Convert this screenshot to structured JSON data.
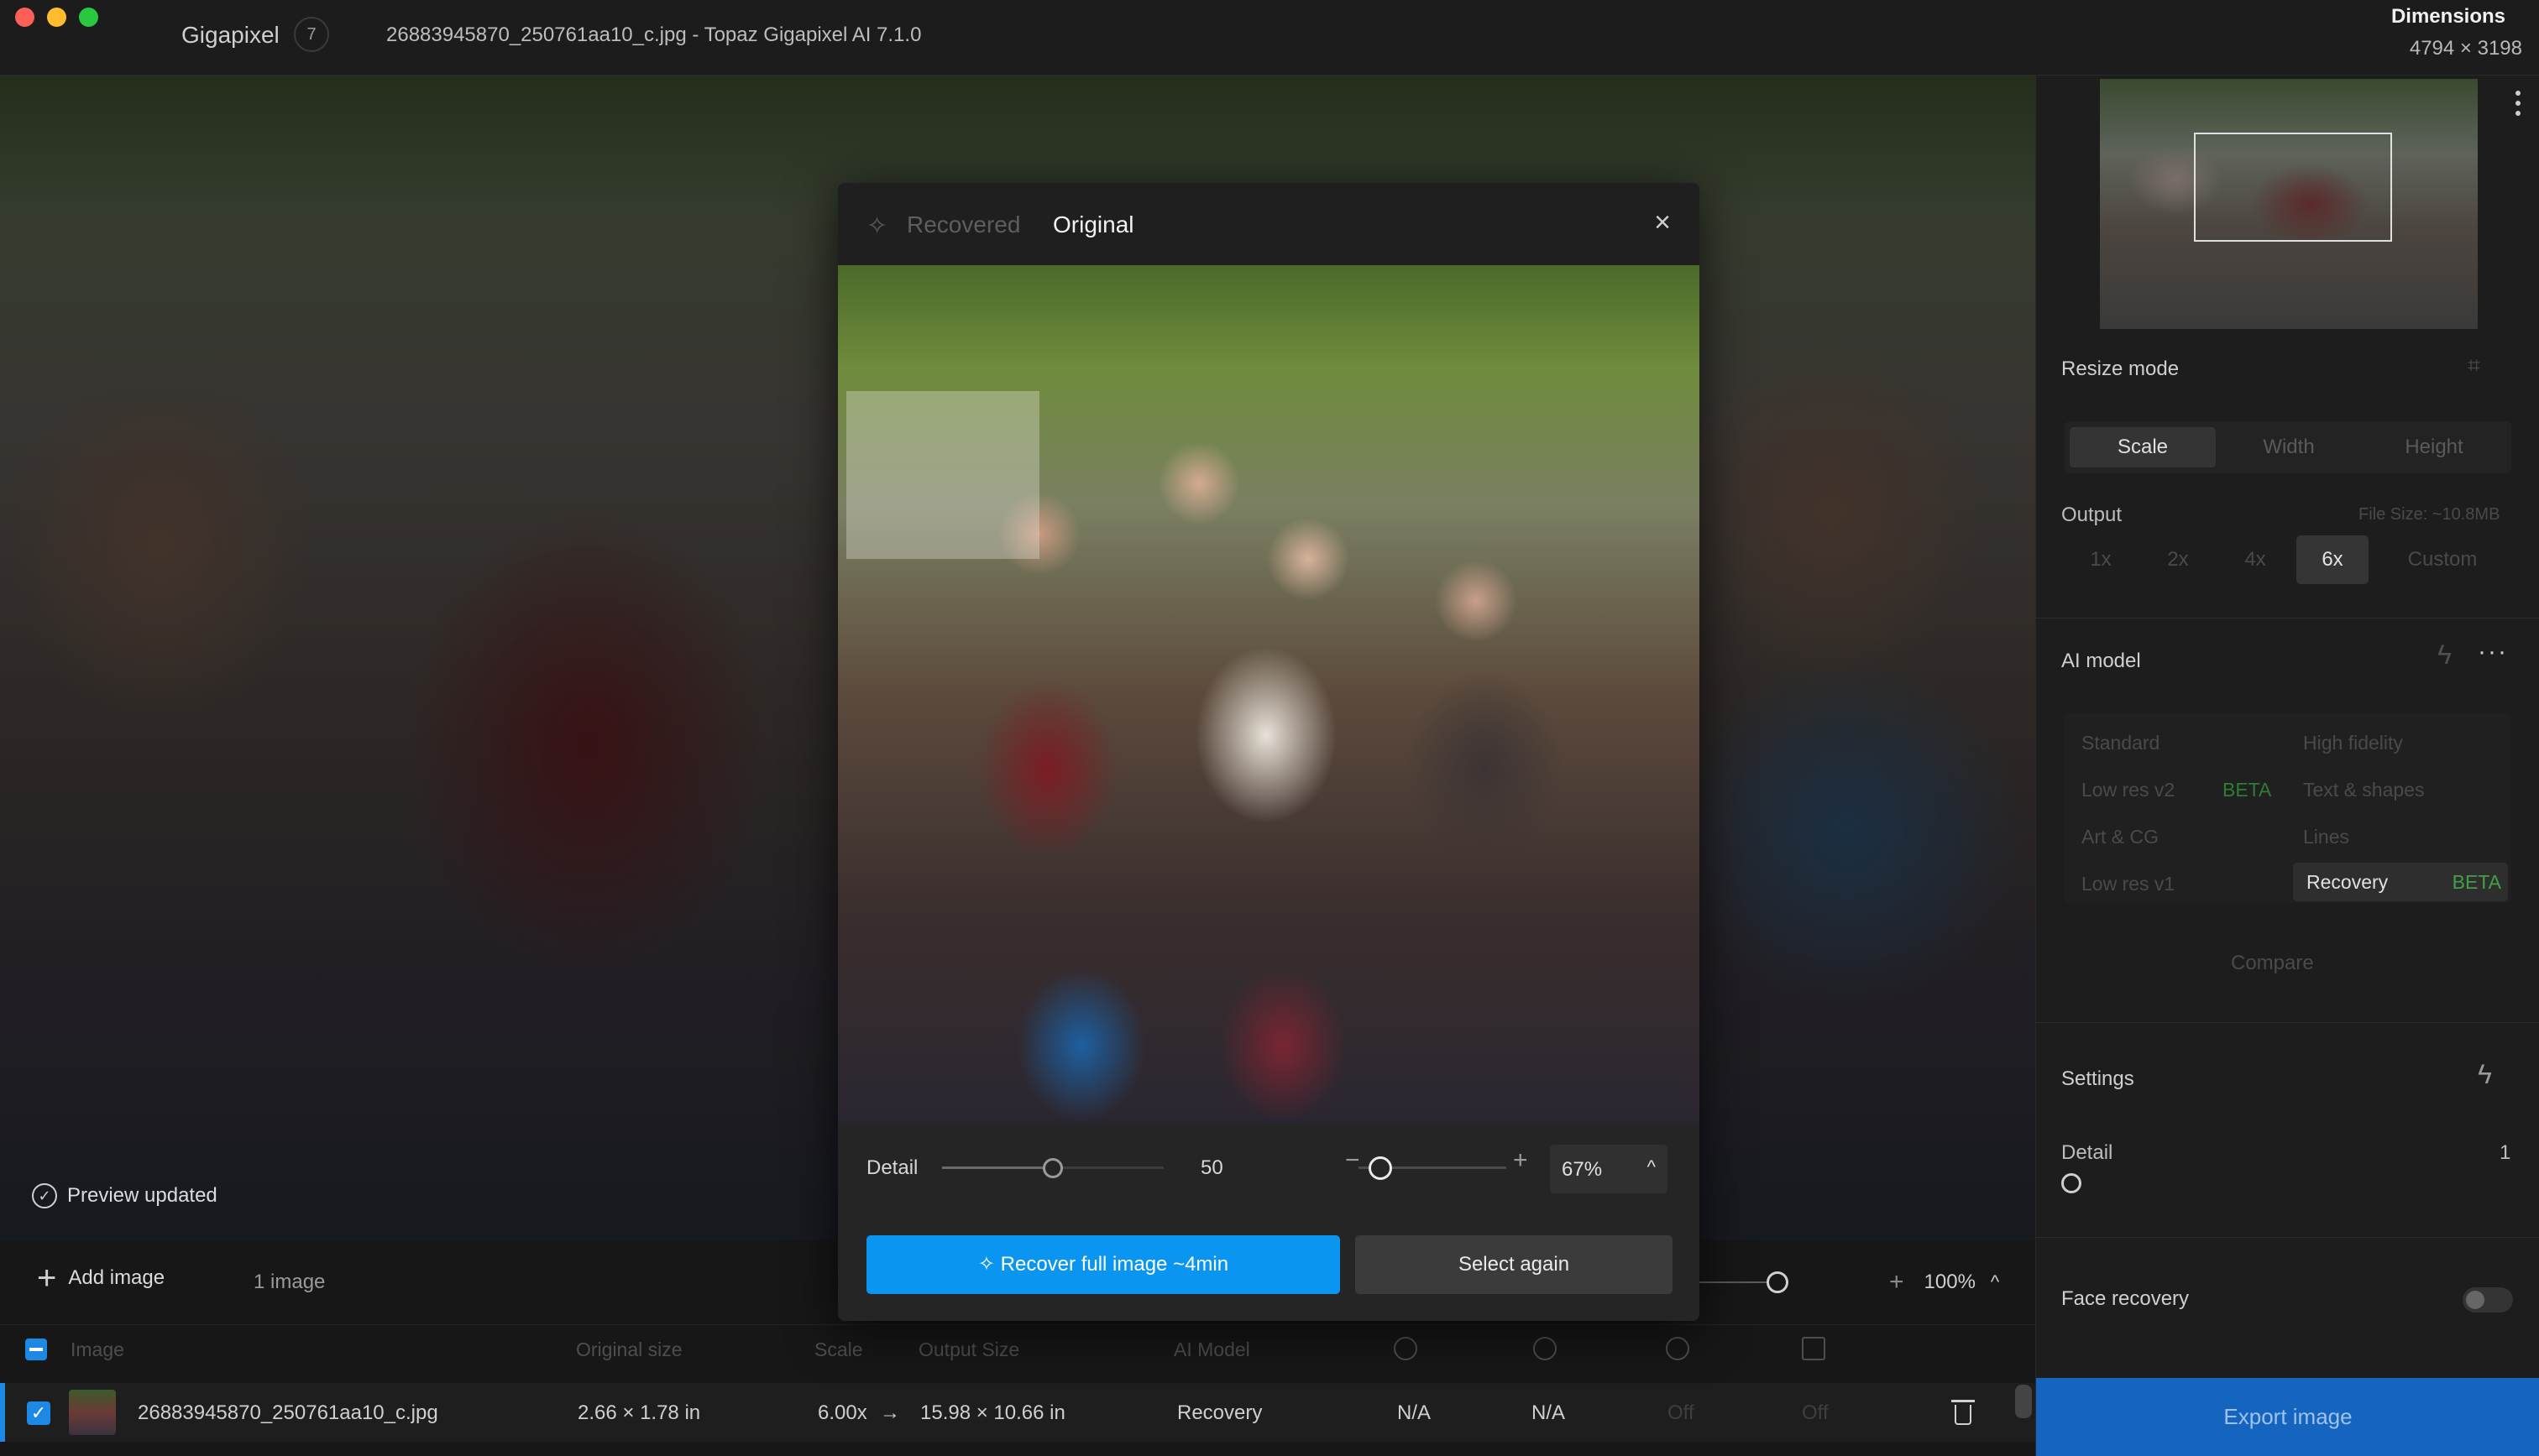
{
  "titlebar": {
    "app_name": "Gigapixel",
    "app_count": "7",
    "window_title": "26883945870_250761aa10_c.jpg - Topaz Gigapixel AI 7.1.0",
    "dimensions_label": "Dimensions",
    "dimensions_value": "4794 × 3198"
  },
  "viewer": {
    "preview_status": "Preview updated",
    "check_glyph": "✓"
  },
  "bottom": {
    "add_image_label": "Add image",
    "plus_glyph": "+",
    "image_count": "1 image",
    "zoom_value": "100%",
    "zoom_plus": "+",
    "chevron": "^"
  },
  "table": {
    "headers": {
      "image": "Image",
      "original_size": "Original size",
      "scale": "Scale",
      "output_size": "Output Size",
      "ai_model": "AI Model"
    },
    "rows": [
      {
        "check": "✓",
        "filename": "26883945870_250761aa10_c.jpg",
        "original_size": "2.66 × 1.78 in",
        "scale": "6.00x",
        "arrow": "→",
        "output_size": "15.98 × 10.66 in",
        "ai_model": "Recovery",
        "col_a": "N/A",
        "col_b": "N/A",
        "col_c": "Off",
        "col_d": "Off"
      }
    ]
  },
  "right_panel": {
    "resize_mode_title": "Resize mode",
    "resize_tabs": [
      "Scale",
      "Width",
      "Height"
    ],
    "output_label": "Output",
    "file_size": "File Size: ~10.8MB",
    "output_options": [
      "1x",
      "2x",
      "4x",
      "6x",
      "Custom"
    ],
    "ai_model_title": "AI model",
    "kebab_glyph": "···",
    "models": {
      "standard": "Standard",
      "high_fidelity": "High fidelity",
      "low_res_v2": "Low res v2",
      "low_res_v2_badge": "BETA",
      "text_shapes": "Text & shapes",
      "art_cg": "Art & CG",
      "lines": "Lines",
      "low_res_v1": "Low res v1",
      "recovery": "Recovery",
      "recovery_badge": "BETA"
    },
    "compare_label": "Compare",
    "settings_title": "Settings",
    "detail_label": "Detail",
    "detail_value": "1",
    "face_recovery_label": "Face recovery",
    "export_label": "Export image"
  },
  "modal": {
    "tab_recovered": "Recovered",
    "tab_original": "Original",
    "close_glyph": "×",
    "sparkle_glyph": "✧",
    "detail_label": "Detail",
    "detail_value": "50",
    "detail_level": 0.5,
    "zoom_minus": "−",
    "zoom_plus": "+",
    "zoom_value": "67%",
    "zoom_chevron": "^",
    "recover_button": "✧ Recover full image ~4min",
    "select_again_button": "Select again"
  },
  "colors": {
    "accent_blue": "#0a96f0",
    "export_blue": "#1565c0",
    "beta_green": "#43a047",
    "checkbox_blue": "#1e88e5"
  }
}
